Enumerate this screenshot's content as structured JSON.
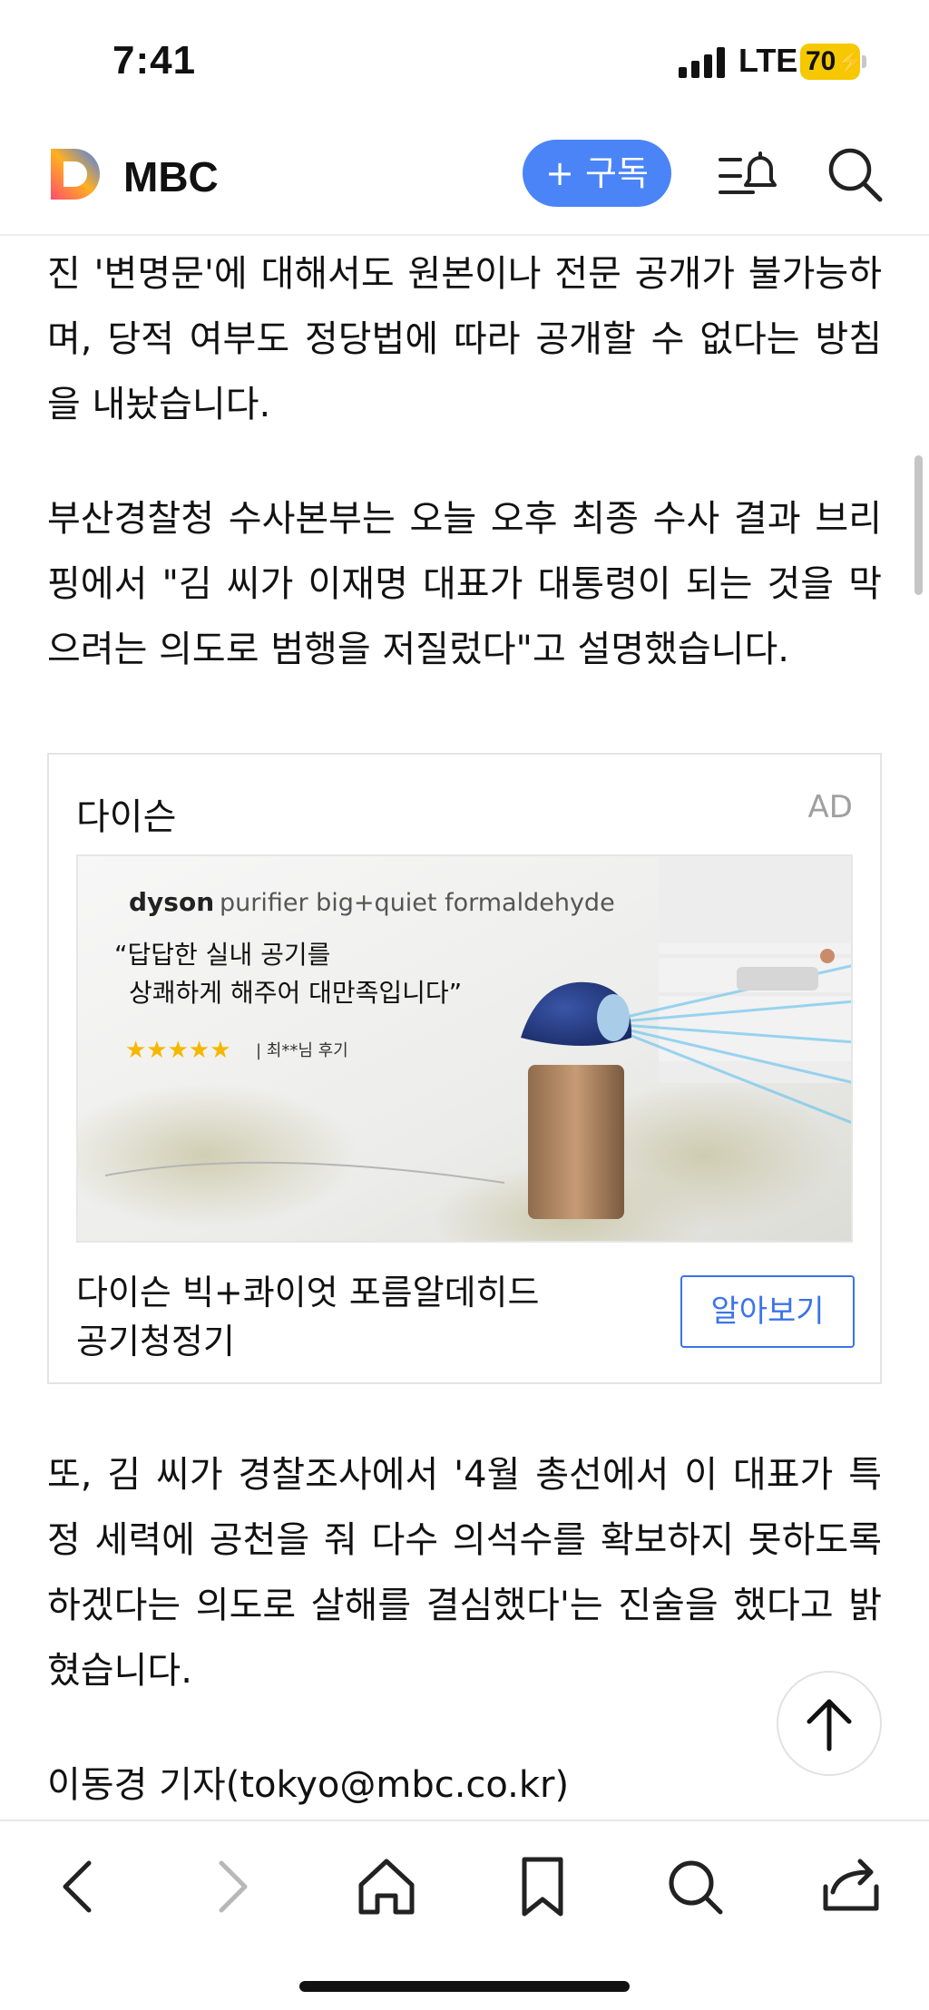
{
  "status_bar": {
    "time": "7:41",
    "network": "LTE",
    "battery": "70"
  },
  "header": {
    "brand": "MBC",
    "subscribe_label": "+ 구독"
  },
  "article": {
    "paragraphs": [
      "진 '변명문'에 대해서도 원본이나 전문 공개가 불가능하며, 당적 여부도 정당법에 따라 공개할 수 없다는 방침을 내놨습니다.",
      "부산경찰청 수사본부는 오늘 오후 최종 수사 결과 브리핑에서 \"김 씨가 이재명 대표가 대통령이 되는 것을 막으려는 의도로 범행을 저질렀다\"고 설명했습니다.",
      "또, 김 씨가 경찰조사에서 '4월 총선에서 이 대표가 특정 세력에 공천을 줘 다수 의석수를 확보하지 못하도록 하겠다는 의도로 살해를 결심했다'는 진술을 했다고 밝혔습니다."
    ],
    "byline": "이동경 기자(tokyo@mbc.co.kr)"
  },
  "ad": {
    "advertiser": "다이슨",
    "tag": "AD",
    "image": {
      "brand": "dyson",
      "product": "purifier big+quiet formaldehyde",
      "quote_line1": "“답답한 실내 공기를",
      "quote_line2": "상쾌하게 해주어 대만족입니다”",
      "stars": "★★★★★",
      "review": "| 최**님 후기"
    },
    "title_line1": "다이슨 빅+콰이엇 포름알데히드",
    "title_line2": "공기청정기",
    "cta_label": "알아보기"
  },
  "colors": {
    "accent": "#4a84f7",
    "cta": "#3b74e8",
    "battery": "#f6c800",
    "star": "#f5b800"
  },
  "icons": [
    "signal-icon",
    "logo-icon",
    "bell-menu-icon",
    "search-icon",
    "arrow-up-icon",
    "back-icon",
    "forward-icon",
    "home-icon",
    "bookmark-icon",
    "find-icon",
    "share-icon"
  ]
}
